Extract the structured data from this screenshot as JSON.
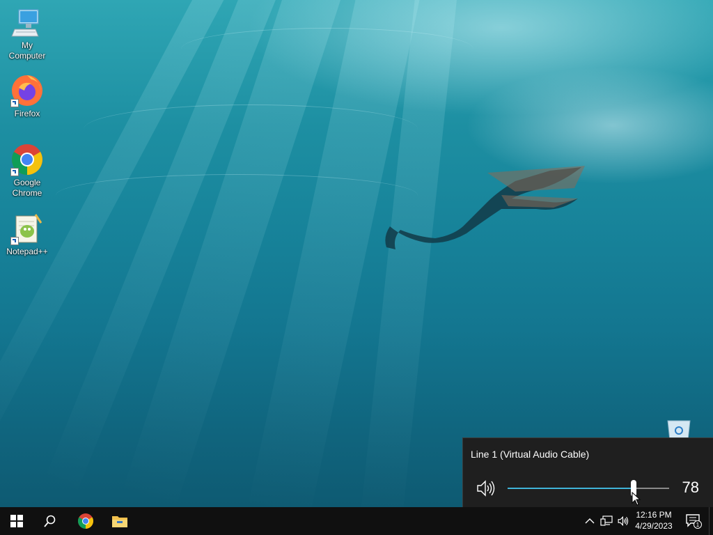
{
  "desktop": {
    "icons": [
      {
        "label": "My Computer",
        "icon": "computer-icon"
      },
      {
        "label": "Firefox",
        "icon": "firefox-icon"
      },
      {
        "label": "Google Chrome",
        "icon": "chrome-icon"
      },
      {
        "label": "Notepad++",
        "icon": "notepad-plus-plus-icon"
      }
    ],
    "recycle_bin_icon": "recycle-bin-icon"
  },
  "volume_flyout": {
    "device_name": "Line 1 (Virtual Audio Cable)",
    "volume": "78",
    "volume_fraction": 0.78,
    "speaker_icon": "speaker-icon",
    "accent_color": "#3fb4d8"
  },
  "taskbar": {
    "start_icon": "windows-logo-icon",
    "search_icon": "search-icon",
    "pinned": [
      "chrome-icon",
      "file-explorer-icon"
    ],
    "tray": {
      "icons": [
        "chevron-up-icon",
        "network-icon",
        "speaker-icon"
      ],
      "time": "12:16 PM",
      "date": "4/29/2023",
      "notification_count": "1"
    }
  }
}
